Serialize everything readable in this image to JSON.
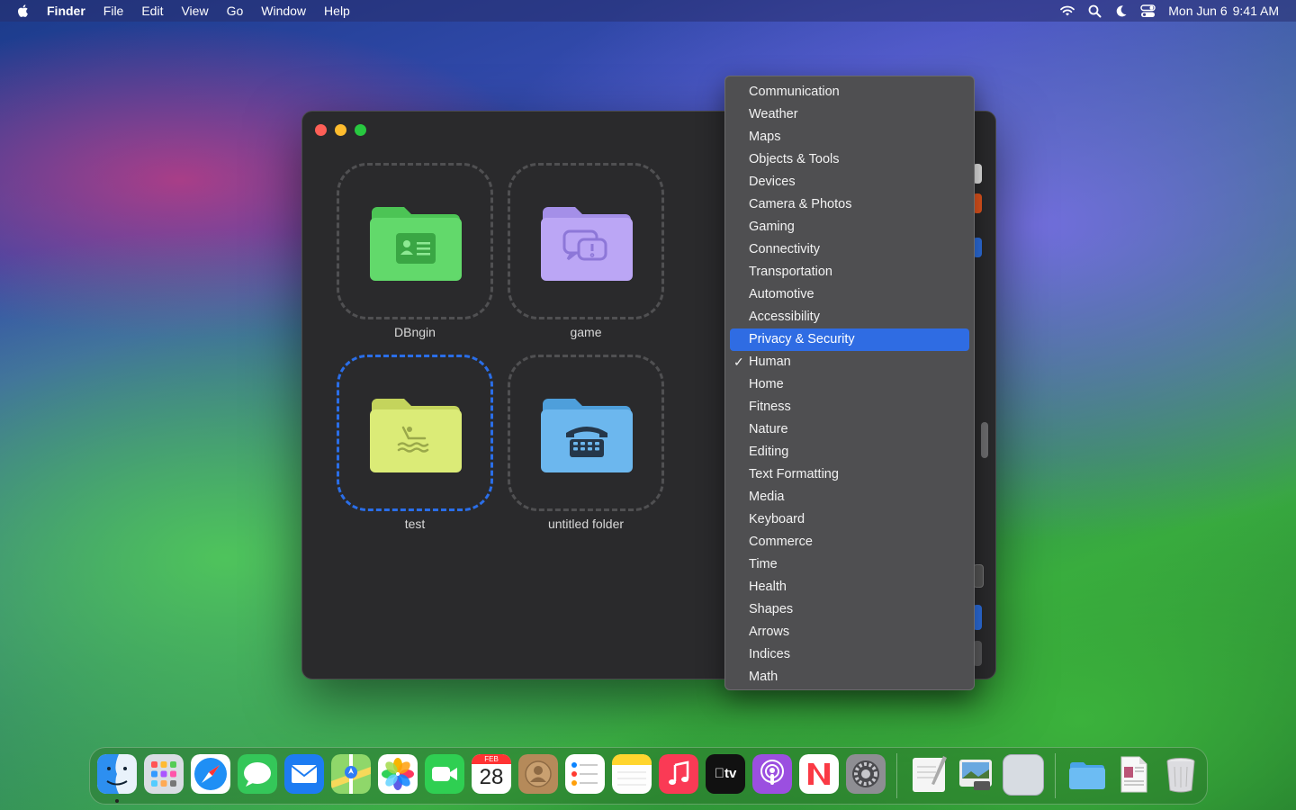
{
  "menubar": {
    "app_name": "Finder",
    "menus": [
      "File",
      "Edit",
      "View",
      "Go",
      "Window",
      "Help"
    ],
    "date": "Mon Jun 6",
    "time": "9:41 AM"
  },
  "window": {
    "folders": [
      {
        "label": "DBngin",
        "color": "#5fd96a",
        "icon": "id-card-icon",
        "selected": false
      },
      {
        "label": "game",
        "color": "#bba6f5",
        "icon": "chat-bubbles-icon",
        "selected": false
      },
      {
        "label": "test",
        "color": "#dbeb77",
        "icon": "swimmer-icon",
        "selected": true
      },
      {
        "label": "untitled folder",
        "color": "#6cb7ee",
        "icon": "phone-icon",
        "selected": false
      }
    ]
  },
  "popup": {
    "items": [
      "Communication",
      "Weather",
      "Maps",
      "Objects & Tools",
      "Devices",
      "Camera & Photos",
      "Gaming",
      "Connectivity",
      "Transportation",
      "Automotive",
      "Accessibility",
      "Privacy & Security",
      "Human",
      "Home",
      "Fitness",
      "Nature",
      "Editing",
      "Text Formatting",
      "Media",
      "Keyboard",
      "Commerce",
      "Time",
      "Health",
      "Shapes",
      "Arrows",
      "Indices",
      "Math"
    ],
    "highlighted": "Privacy & Security",
    "checked": "Human",
    "check_mark": "✓"
  },
  "dock": {
    "apps": [
      "finder-icon",
      "launchpad-icon",
      "safari-icon",
      "messages-icon",
      "mail-icon",
      "maps-icon",
      "photos-icon",
      "facetime-icon",
      "calendar-icon",
      "contacts-icon",
      "reminders-icon",
      "notes-icon",
      "music-icon",
      "tv-icon",
      "podcasts-icon",
      "news-icon",
      "system-settings-icon",
      "textedit-icon",
      "preview-icon",
      "app-icon",
      "folder-icon",
      "document-icon",
      "trash-icon"
    ],
    "calendar": {
      "month": "FEB",
      "day": "28"
    },
    "tv_label": "tv"
  }
}
